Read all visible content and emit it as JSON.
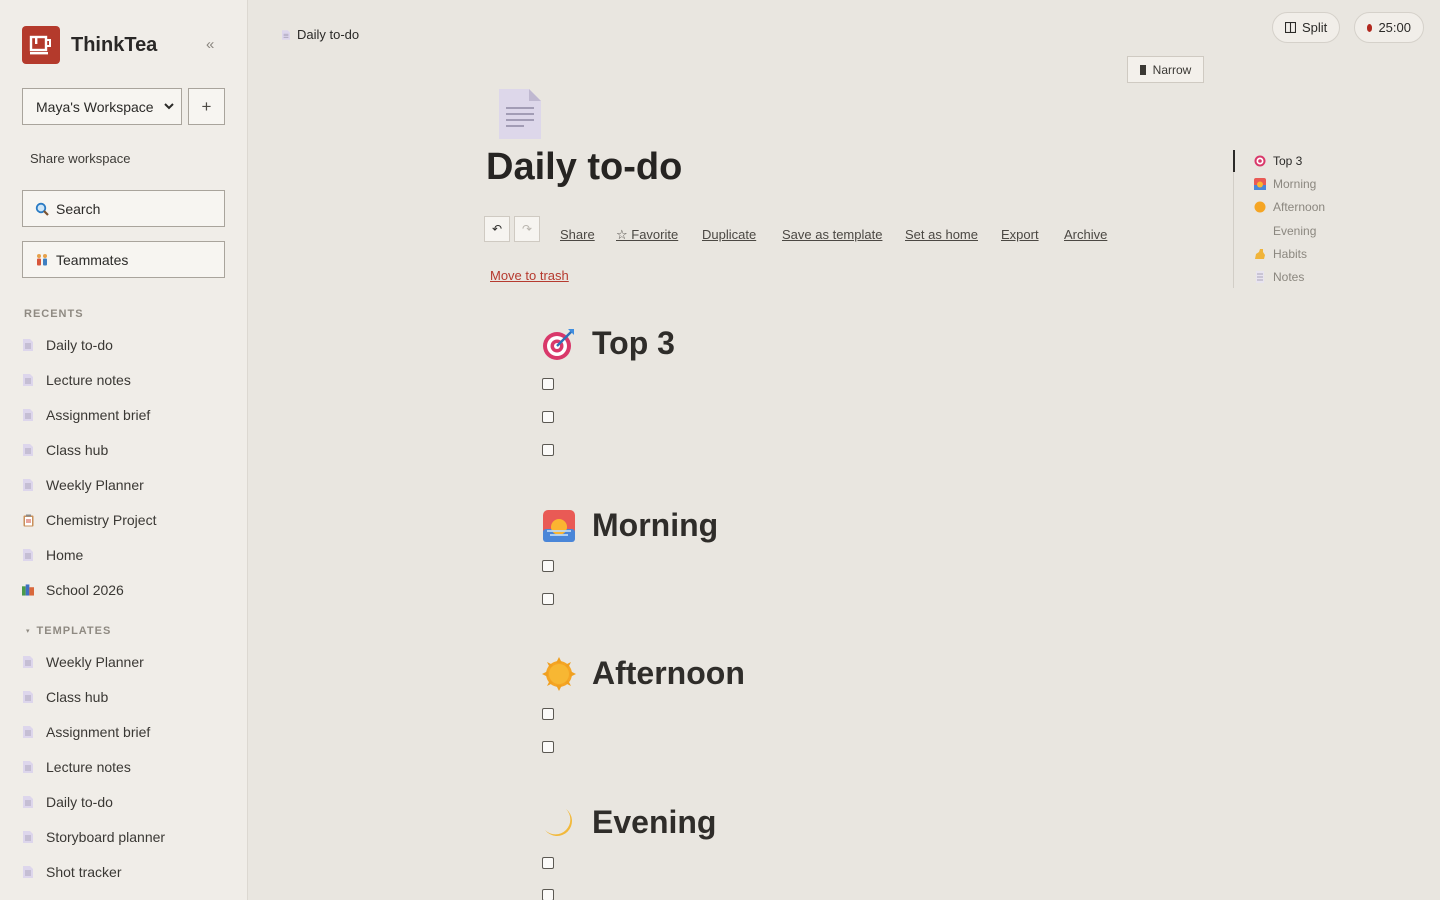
{
  "app": {
    "name": "ThinkTea",
    "collapse_glyph": "«"
  },
  "workspace": {
    "selected": "Maya's Workspace",
    "add_label": "+",
    "share_label": "Share workspace"
  },
  "search": {
    "label": "Search"
  },
  "teammates": {
    "label": "Teammates"
  },
  "recents": {
    "label": "RECENTS",
    "items": [
      {
        "label": "Daily to-do",
        "icon": "page-icon"
      },
      {
        "label": "Lecture notes",
        "icon": "page-icon"
      },
      {
        "label": "Assignment brief",
        "icon": "page-icon"
      },
      {
        "label": "Class hub",
        "icon": "page-icon"
      },
      {
        "label": "Weekly Planner",
        "icon": "page-icon"
      },
      {
        "label": "Chemistry Project",
        "icon": "clipboard-icon"
      },
      {
        "label": "Home",
        "icon": "page-icon"
      },
      {
        "label": "School 2026",
        "icon": "books-icon"
      }
    ]
  },
  "templates": {
    "label": "TEMPLATES",
    "items": [
      {
        "label": "Weekly Planner"
      },
      {
        "label": "Class hub"
      },
      {
        "label": "Assignment brief"
      },
      {
        "label": "Lecture notes"
      },
      {
        "label": "Daily to-do"
      },
      {
        "label": "Storyboard planner"
      },
      {
        "label": "Shot tracker"
      }
    ]
  },
  "topbar": {
    "breadcrumb": "Daily to-do",
    "split_label": "Split",
    "timer": "25:00",
    "narrow_label": "Narrow"
  },
  "doc": {
    "title": "Daily to-do",
    "undo_glyph": "↶",
    "redo_glyph": "↷",
    "actions": [
      "Share",
      "☆ Favorite",
      "Duplicate",
      "Save as template",
      "Set as home",
      "Export",
      "Archive"
    ],
    "trash_label": "Move to trash",
    "sections": [
      {
        "title": "Top 3",
        "icon": "target-icon",
        "checkboxes": 3
      },
      {
        "title": "Morning",
        "icon": "sunrise-icon",
        "checkboxes": 2
      },
      {
        "title": "Afternoon",
        "icon": "sun-icon",
        "checkboxes": 2
      },
      {
        "title": "Evening",
        "icon": "moon-icon",
        "checkboxes": 2
      }
    ]
  },
  "outline": {
    "items": [
      {
        "label": "Top 3",
        "icon": "target-icon",
        "active": true
      },
      {
        "label": "Morning",
        "icon": "sunrise-icon"
      },
      {
        "label": "Afternoon",
        "icon": "sun-icon"
      },
      {
        "label": "Evening",
        "icon": "moon-icon"
      },
      {
        "label": "Habits",
        "icon": "flexed-arm-icon"
      },
      {
        "label": "Notes",
        "icon": "note-icon"
      }
    ]
  },
  "colors": {
    "accent": "#b43a2c",
    "background": "#e9e6e0",
    "sidebar": "#f0ede8",
    "timer_dot": "#b1281e"
  }
}
